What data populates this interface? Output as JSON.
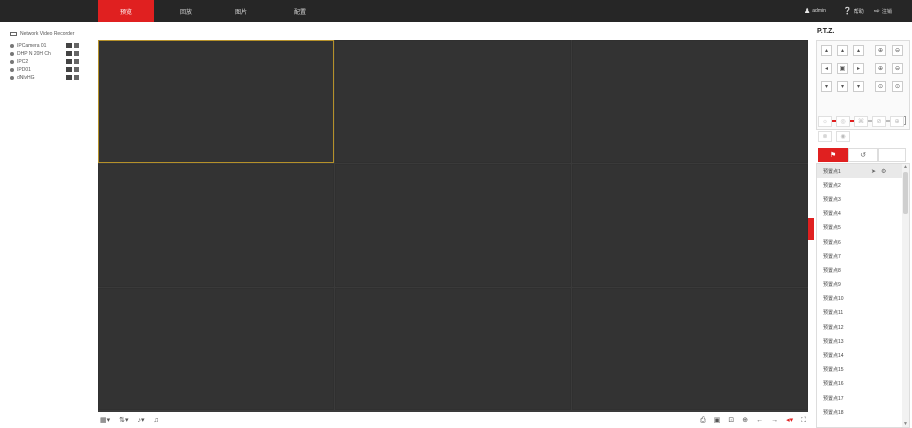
{
  "topbar": {
    "tabs": [
      {
        "label": "预览",
        "active": true
      },
      {
        "label": "回放",
        "active": false
      },
      {
        "label": "图片",
        "active": false
      },
      {
        "label": "配置",
        "active": false
      }
    ],
    "user": {
      "icon": "user-icon",
      "label": "admin"
    },
    "help": {
      "icon": "help-icon",
      "label": "帮助"
    },
    "logout": {
      "icon": "logout-icon",
      "label": "注销"
    }
  },
  "device_tree": {
    "root_label": "Network Video Recorder",
    "channels": [
      {
        "label": "IPCamera 01"
      },
      {
        "label": "DHP N 20H Ch"
      },
      {
        "label": "IPC2"
      },
      {
        "label": "IPD01"
      },
      {
        "label": "dNlvHG"
      }
    ]
  },
  "video_grid": {
    "columns": 3,
    "rows": 3,
    "selected_index": 0
  },
  "bottom_toolbar": {
    "left": [
      {
        "name": "layout-icon",
        "glyph": "▦▾"
      },
      {
        "name": "stream-icon",
        "glyph": "⇅▾"
      },
      {
        "name": "audio-icon",
        "glyph": "♪▾"
      },
      {
        "name": "talk-icon",
        "glyph": "♫"
      }
    ],
    "right": [
      {
        "name": "capture-icon",
        "glyph": "⎙"
      },
      {
        "name": "record-icon",
        "glyph": "▣"
      },
      {
        "name": "digital-zoom-icon",
        "glyph": "⊡"
      },
      {
        "name": "zoom-icon",
        "glyph": "⊕"
      },
      {
        "name": "prev-page-icon",
        "glyph": "←"
      },
      {
        "name": "next-page-icon",
        "glyph": "→"
      },
      {
        "name": "volume-icon",
        "glyph": "◂▾"
      },
      {
        "name": "fullscreen-icon",
        "glyph": "⛶"
      }
    ]
  },
  "ptz": {
    "title": "P.T.Z.",
    "direction_pad": [
      "▴",
      "▴",
      "▴",
      "◂",
      "▣",
      "▸",
      "▾",
      "▾",
      "▾"
    ],
    "zoom_buttons": [
      "⊕",
      "⊖",
      "⊕",
      "⊖",
      "⊙",
      "⊙"
    ],
    "speed_knob": "4",
    "function_buttons": [
      "☼",
      "◎",
      "⌘",
      "⊘",
      "⊕",
      "⊗",
      "◉"
    ],
    "preset_tab_preset_icon": "flag-icon",
    "preset_tab_patrol_icon": "patrol-icon",
    "presets": [
      {
        "label": "预置点1"
      },
      {
        "label": "预置点2"
      },
      {
        "label": "预置点3"
      },
      {
        "label": "预置点4"
      },
      {
        "label": "预置点5"
      },
      {
        "label": "预置点6"
      },
      {
        "label": "预置点7"
      },
      {
        "label": "预置点8"
      },
      {
        "label": "预置点9"
      },
      {
        "label": "预置点10"
      },
      {
        "label": "预置点11"
      },
      {
        "label": "预置点12"
      },
      {
        "label": "预置点13"
      },
      {
        "label": "预置点14"
      },
      {
        "label": "预置点15"
      },
      {
        "label": "预置点16"
      },
      {
        "label": "预置点17"
      },
      {
        "label": "预置点18"
      }
    ]
  },
  "colors": {
    "accent": "#e02020",
    "topbar": "#262626",
    "video_bg": "#333333",
    "selected_border": "#b5912a"
  }
}
